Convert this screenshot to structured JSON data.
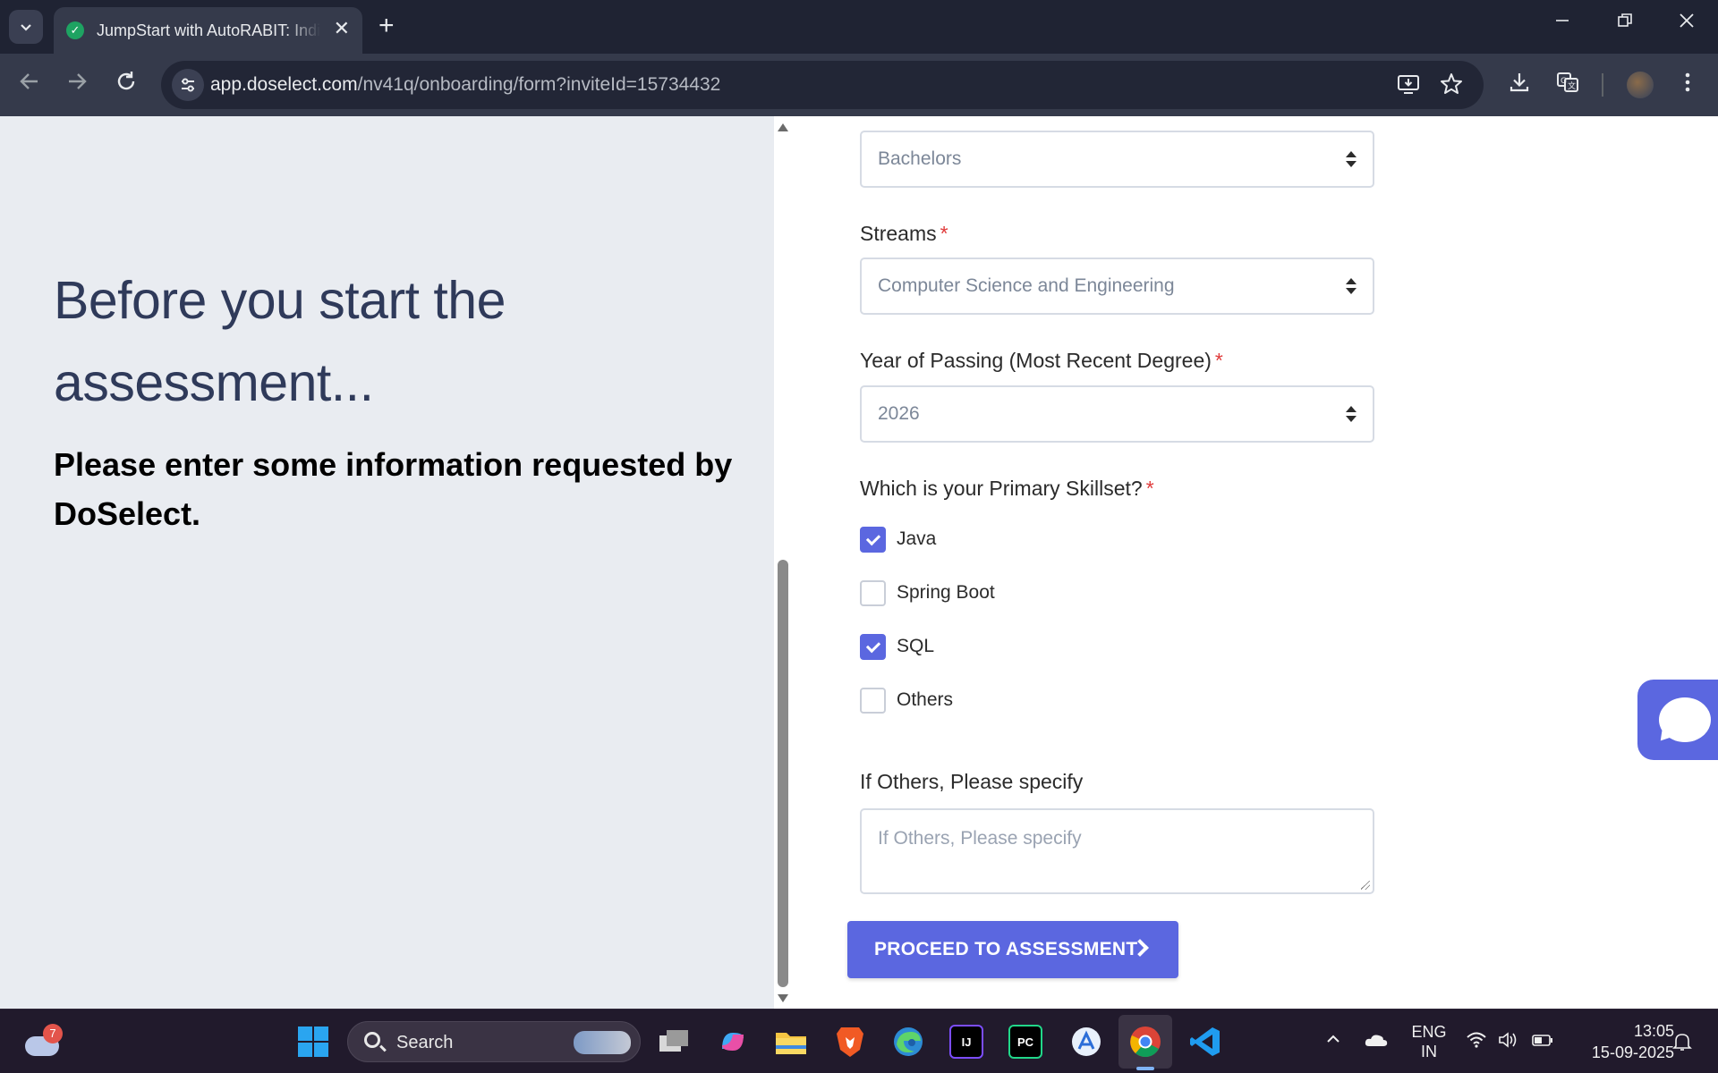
{
  "browser": {
    "tab_title": "JumpStart with AutoRABIT: India",
    "tab_close": "✕",
    "new_tab": "+",
    "url_host": "app.doselect.com",
    "url_path": "/nv41q/onboarding/form?inviteId=15734432"
  },
  "left_panel": {
    "headline": "Before you start the assessment...",
    "subline": "Please enter some information requested by DoSelect."
  },
  "form": {
    "degree": {
      "value": "Bachelors"
    },
    "streams": {
      "label": "Streams",
      "required": "*",
      "value": "Computer Science and Engineering"
    },
    "year": {
      "label": "Year of Passing (Most Recent Degree)",
      "required": "*",
      "value": "2026"
    },
    "skillset": {
      "label": "Which is your Primary Skillset?",
      "required": "*",
      "options": [
        {
          "label": "Java",
          "checked": true
        },
        {
          "label": "Spring Boot",
          "checked": false
        },
        {
          "label": "SQL",
          "checked": true
        },
        {
          "label": "Others",
          "checked": false
        }
      ]
    },
    "others": {
      "label": "If Others, Please specify",
      "placeholder": "If Others, Please specify"
    },
    "submit_label": "PROCEED TO ASSESSMENT"
  },
  "taskbar": {
    "weather_badge": "7",
    "search_text": "Search",
    "lang_line1": "ENG",
    "lang_line2": "IN",
    "time": "13:05",
    "date": "15-09-2025"
  },
  "colors": {
    "accent": "#5b67e0",
    "required": "#e03b3b",
    "left_panel_bg": "#e9ecf1"
  }
}
